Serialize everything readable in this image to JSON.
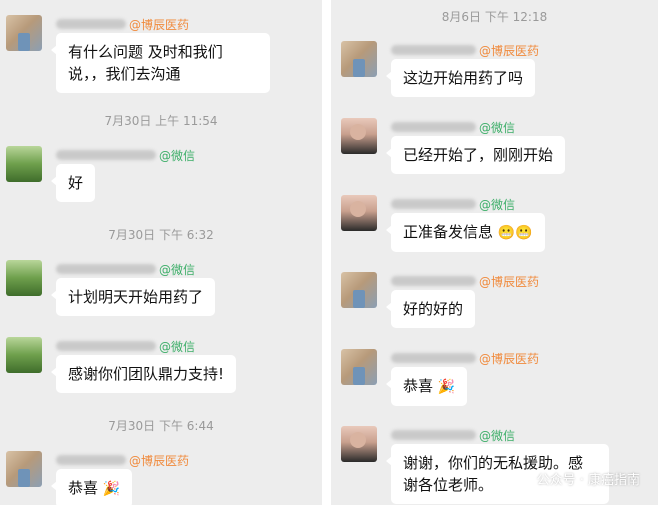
{
  "left": {
    "messages": [
      {
        "org": "@博辰医药",
        "text": "有什么问题 及时和我们说，，我们去沟通",
        "avatar": "doctor-avatar"
      },
      {
        "time": "7月30日 上午 11:54"
      },
      {
        "org": "@微信",
        "text": "好",
        "avatar": "field-avatar"
      },
      {
        "time": "7月30日 下午 6:32"
      },
      {
        "org": "@微信",
        "text": "计划明天开始用药了",
        "avatar": "field-avatar"
      },
      {
        "org": "@微信",
        "text": "感谢你们团队鼎力支持!",
        "avatar": "field-avatar"
      },
      {
        "time": "7月30日 下午 6:44"
      },
      {
        "org": "@博辰医药",
        "text": "恭喜",
        "emoji": "🎉",
        "avatar": "doctor-avatar"
      }
    ]
  },
  "right": {
    "messages": [
      {
        "time": "8月6日 下午 12:18"
      },
      {
        "org": "@博辰医药",
        "text": "这边开始用药了吗",
        "avatar": "doctor-avatar"
      },
      {
        "org": "@微信",
        "text": "已经开始了，刚刚开始",
        "avatar": "person-avatar"
      },
      {
        "org": "@微信",
        "text": "正准备发信息",
        "emoji": "😬😬",
        "avatar": "person-avatar"
      },
      {
        "org": "@博辰医药",
        "text": "好的好的",
        "avatar": "doctor-avatar"
      },
      {
        "org": "@博辰医药",
        "text": "恭喜",
        "emoji": "🎉",
        "avatar": "doctor-avatar"
      },
      {
        "org": "@微信",
        "text": "谢谢，你们的无私援助。感谢各位老师。",
        "avatar": "person-avatar"
      }
    ]
  },
  "watermark": "公众号 · 康癌指南",
  "colors": {
    "background": "#ededed",
    "bubble": "#ffffff",
    "org_orange": "#f08a3c",
    "org_green": "#3cae68",
    "timestamp": "#9a9a9a"
  }
}
